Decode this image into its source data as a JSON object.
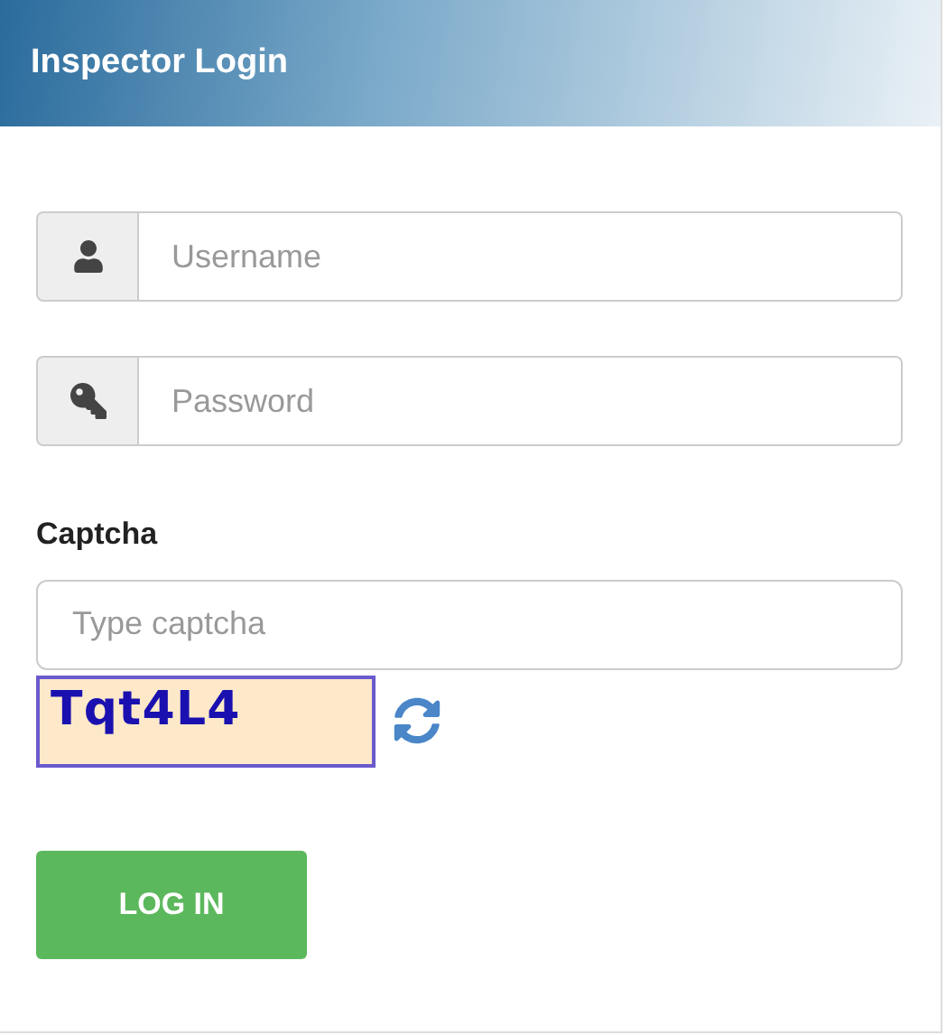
{
  "header": {
    "title": "Inspector Login"
  },
  "fields": [
    {
      "kind": "user",
      "placeholder": "Username"
    },
    {
      "kind": "key",
      "placeholder": "Password"
    }
  ],
  "captcha": {
    "label": "Captcha",
    "placeholder": "Type captcha",
    "code": "Tqt4L4"
  },
  "button": "LOG IN"
}
